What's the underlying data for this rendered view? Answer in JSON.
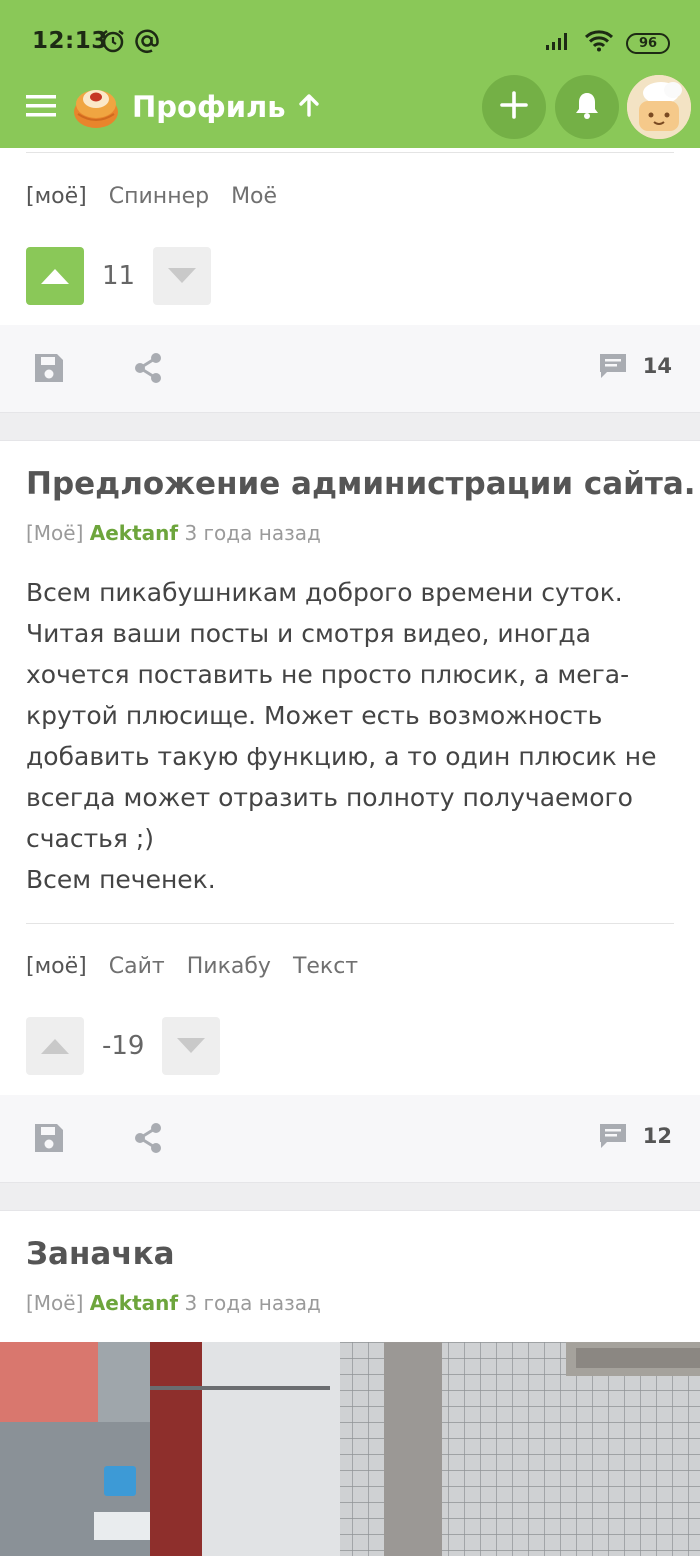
{
  "status_bar": {
    "time": "12:13",
    "battery": "96"
  },
  "app_bar": {
    "title": "Профиль"
  },
  "post1": {
    "tags": [
      "[моё]",
      "Спиннер",
      "Моё"
    ],
    "rating": "11",
    "comments": "14"
  },
  "post2": {
    "title": "Предложение администрации сайта.",
    "community": "[Моё]",
    "author": "Aektanf",
    "time": "3 года назад",
    "body": [
      "Всем пикабушникам доброго времени суток.",
      "Читая ваши посты и смотря видео, иногда",
      "хочется поставить не просто плюсик, а мега-",
      "крутой плюсище. Может есть возможность",
      "добавить такую функцию, а то один плюсик не",
      "всегда может отразить полноту получаемого",
      "счастья ;)",
      "Всем печенек."
    ],
    "tags": [
      "[моё]",
      "Сайт",
      "Пикабу",
      "Текст"
    ],
    "rating": "-19",
    "comments": "12"
  },
  "post3": {
    "title": "Заначка",
    "community": "[Моё]",
    "author": "Aektanf",
    "time": "3 года назад"
  },
  "colors": {
    "brand": "#8ac858",
    "author": "#6da53c"
  }
}
